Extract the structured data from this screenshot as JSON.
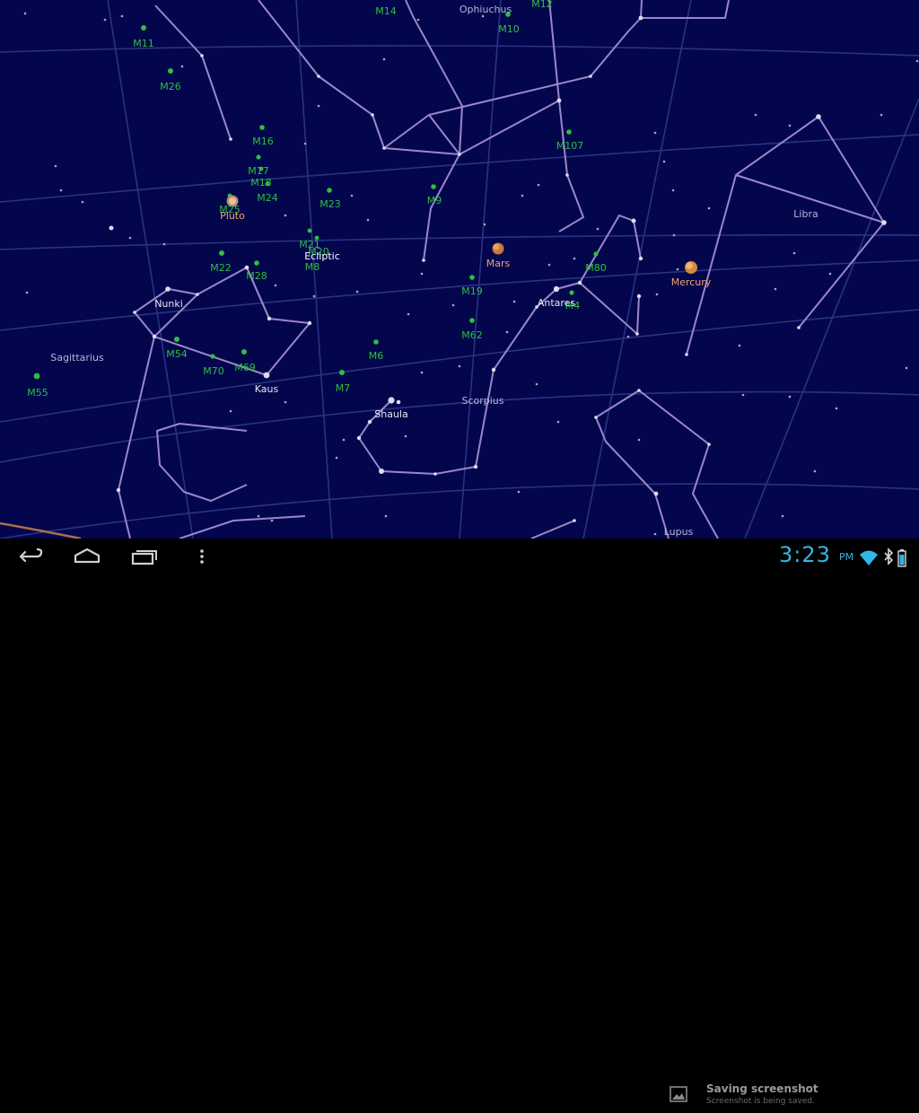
{
  "sky_map": {
    "constellations": [
      "Ophiuchus",
      "Libra",
      "Sagittarius",
      "Scorpius",
      "Lupus"
    ],
    "stars": [
      "Nunki",
      "Kaus",
      "Shaula",
      "Antares"
    ],
    "planets": [
      "Pluto",
      "Mars",
      "Mercury"
    ],
    "ecliptic_label": "Ecliptic",
    "messier_objects": [
      "M14",
      "M12",
      "M10",
      "M11",
      "M26",
      "M16",
      "M17",
      "M18",
      "M24",
      "M25",
      "M23",
      "M9",
      "M107",
      "M21",
      "M20",
      "M8",
      "M22",
      "M28",
      "M19",
      "M80",
      "M4",
      "M62",
      "M54",
      "M70",
      "M69",
      "M6",
      "M7",
      "M55"
    ],
    "colors": {
      "sky_background": "#03064d",
      "constellation_line": "#9c86c9",
      "grid_line": "#2f3c8a",
      "messier_label": "#2fbf3f",
      "planet_label": "#f2a36a",
      "constellation_label": "#b9b4d8",
      "star_label": "#e8e8f0"
    }
  },
  "navigation_bar": {
    "buttons": [
      "back",
      "home",
      "recent-apps",
      "menu"
    ]
  },
  "notification": {
    "title": "Saving screenshot",
    "subtitle": "Screenshot is being saved."
  },
  "status_bar": {
    "time": "3:23",
    "ampm": "PM",
    "accent": "#33b5e5"
  }
}
